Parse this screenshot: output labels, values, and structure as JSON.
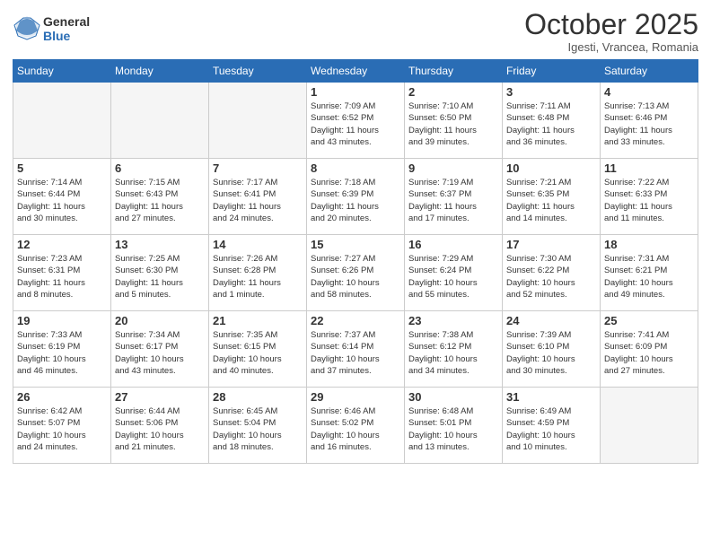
{
  "header": {
    "logo_general": "General",
    "logo_blue": "Blue",
    "title": "October 2025",
    "subtitle": "Igesti, Vrancea, Romania"
  },
  "weekdays": [
    "Sunday",
    "Monday",
    "Tuesday",
    "Wednesday",
    "Thursday",
    "Friday",
    "Saturday"
  ],
  "weeks": [
    [
      {
        "day": "",
        "info": ""
      },
      {
        "day": "",
        "info": ""
      },
      {
        "day": "",
        "info": ""
      },
      {
        "day": "1",
        "info": "Sunrise: 7:09 AM\nSunset: 6:52 PM\nDaylight: 11 hours\nand 43 minutes."
      },
      {
        "day": "2",
        "info": "Sunrise: 7:10 AM\nSunset: 6:50 PM\nDaylight: 11 hours\nand 39 minutes."
      },
      {
        "day": "3",
        "info": "Sunrise: 7:11 AM\nSunset: 6:48 PM\nDaylight: 11 hours\nand 36 minutes."
      },
      {
        "day": "4",
        "info": "Sunrise: 7:13 AM\nSunset: 6:46 PM\nDaylight: 11 hours\nand 33 minutes."
      }
    ],
    [
      {
        "day": "5",
        "info": "Sunrise: 7:14 AM\nSunset: 6:44 PM\nDaylight: 11 hours\nand 30 minutes."
      },
      {
        "day": "6",
        "info": "Sunrise: 7:15 AM\nSunset: 6:43 PM\nDaylight: 11 hours\nand 27 minutes."
      },
      {
        "day": "7",
        "info": "Sunrise: 7:17 AM\nSunset: 6:41 PM\nDaylight: 11 hours\nand 24 minutes."
      },
      {
        "day": "8",
        "info": "Sunrise: 7:18 AM\nSunset: 6:39 PM\nDaylight: 11 hours\nand 20 minutes."
      },
      {
        "day": "9",
        "info": "Sunrise: 7:19 AM\nSunset: 6:37 PM\nDaylight: 11 hours\nand 17 minutes."
      },
      {
        "day": "10",
        "info": "Sunrise: 7:21 AM\nSunset: 6:35 PM\nDaylight: 11 hours\nand 14 minutes."
      },
      {
        "day": "11",
        "info": "Sunrise: 7:22 AM\nSunset: 6:33 PM\nDaylight: 11 hours\nand 11 minutes."
      }
    ],
    [
      {
        "day": "12",
        "info": "Sunrise: 7:23 AM\nSunset: 6:31 PM\nDaylight: 11 hours\nand 8 minutes."
      },
      {
        "day": "13",
        "info": "Sunrise: 7:25 AM\nSunset: 6:30 PM\nDaylight: 11 hours\nand 5 minutes."
      },
      {
        "day": "14",
        "info": "Sunrise: 7:26 AM\nSunset: 6:28 PM\nDaylight: 11 hours\nand 1 minute."
      },
      {
        "day": "15",
        "info": "Sunrise: 7:27 AM\nSunset: 6:26 PM\nDaylight: 10 hours\nand 58 minutes."
      },
      {
        "day": "16",
        "info": "Sunrise: 7:29 AM\nSunset: 6:24 PM\nDaylight: 10 hours\nand 55 minutes."
      },
      {
        "day": "17",
        "info": "Sunrise: 7:30 AM\nSunset: 6:22 PM\nDaylight: 10 hours\nand 52 minutes."
      },
      {
        "day": "18",
        "info": "Sunrise: 7:31 AM\nSunset: 6:21 PM\nDaylight: 10 hours\nand 49 minutes."
      }
    ],
    [
      {
        "day": "19",
        "info": "Sunrise: 7:33 AM\nSunset: 6:19 PM\nDaylight: 10 hours\nand 46 minutes."
      },
      {
        "day": "20",
        "info": "Sunrise: 7:34 AM\nSunset: 6:17 PM\nDaylight: 10 hours\nand 43 minutes."
      },
      {
        "day": "21",
        "info": "Sunrise: 7:35 AM\nSunset: 6:15 PM\nDaylight: 10 hours\nand 40 minutes."
      },
      {
        "day": "22",
        "info": "Sunrise: 7:37 AM\nSunset: 6:14 PM\nDaylight: 10 hours\nand 37 minutes."
      },
      {
        "day": "23",
        "info": "Sunrise: 7:38 AM\nSunset: 6:12 PM\nDaylight: 10 hours\nand 34 minutes."
      },
      {
        "day": "24",
        "info": "Sunrise: 7:39 AM\nSunset: 6:10 PM\nDaylight: 10 hours\nand 30 minutes."
      },
      {
        "day": "25",
        "info": "Sunrise: 7:41 AM\nSunset: 6:09 PM\nDaylight: 10 hours\nand 27 minutes."
      }
    ],
    [
      {
        "day": "26",
        "info": "Sunrise: 6:42 AM\nSunset: 5:07 PM\nDaylight: 10 hours\nand 24 minutes."
      },
      {
        "day": "27",
        "info": "Sunrise: 6:44 AM\nSunset: 5:06 PM\nDaylight: 10 hours\nand 21 minutes."
      },
      {
        "day": "28",
        "info": "Sunrise: 6:45 AM\nSunset: 5:04 PM\nDaylight: 10 hours\nand 18 minutes."
      },
      {
        "day": "29",
        "info": "Sunrise: 6:46 AM\nSunset: 5:02 PM\nDaylight: 10 hours\nand 16 minutes."
      },
      {
        "day": "30",
        "info": "Sunrise: 6:48 AM\nSunset: 5:01 PM\nDaylight: 10 hours\nand 13 minutes."
      },
      {
        "day": "31",
        "info": "Sunrise: 6:49 AM\nSunset: 4:59 PM\nDaylight: 10 hours\nand 10 minutes."
      },
      {
        "day": "",
        "info": ""
      }
    ]
  ]
}
